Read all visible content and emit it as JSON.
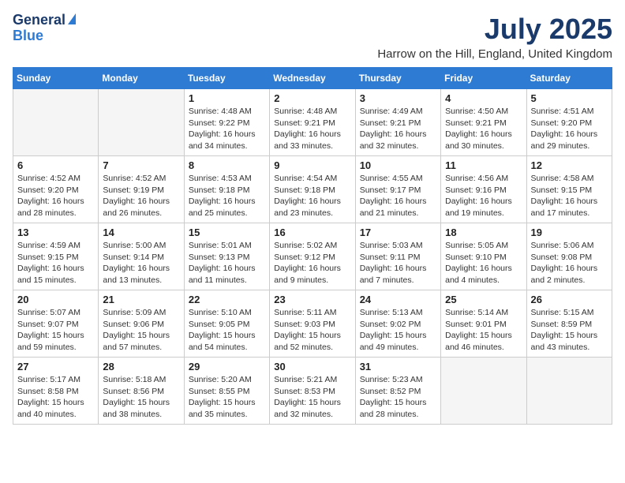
{
  "logo": {
    "line1": "General",
    "line2": "Blue"
  },
  "title": "July 2025",
  "location": "Harrow on the Hill, England, United Kingdom",
  "weekdays": [
    "Sunday",
    "Monday",
    "Tuesday",
    "Wednesday",
    "Thursday",
    "Friday",
    "Saturday"
  ],
  "weeks": [
    [
      {
        "day": "",
        "detail": ""
      },
      {
        "day": "",
        "detail": ""
      },
      {
        "day": "1",
        "detail": "Sunrise: 4:48 AM\nSunset: 9:22 PM\nDaylight: 16 hours\nand 34 minutes."
      },
      {
        "day": "2",
        "detail": "Sunrise: 4:48 AM\nSunset: 9:21 PM\nDaylight: 16 hours\nand 33 minutes."
      },
      {
        "day": "3",
        "detail": "Sunrise: 4:49 AM\nSunset: 9:21 PM\nDaylight: 16 hours\nand 32 minutes."
      },
      {
        "day": "4",
        "detail": "Sunrise: 4:50 AM\nSunset: 9:21 PM\nDaylight: 16 hours\nand 30 minutes."
      },
      {
        "day": "5",
        "detail": "Sunrise: 4:51 AM\nSunset: 9:20 PM\nDaylight: 16 hours\nand 29 minutes."
      }
    ],
    [
      {
        "day": "6",
        "detail": "Sunrise: 4:52 AM\nSunset: 9:20 PM\nDaylight: 16 hours\nand 28 minutes."
      },
      {
        "day": "7",
        "detail": "Sunrise: 4:52 AM\nSunset: 9:19 PM\nDaylight: 16 hours\nand 26 minutes."
      },
      {
        "day": "8",
        "detail": "Sunrise: 4:53 AM\nSunset: 9:18 PM\nDaylight: 16 hours\nand 25 minutes."
      },
      {
        "day": "9",
        "detail": "Sunrise: 4:54 AM\nSunset: 9:18 PM\nDaylight: 16 hours\nand 23 minutes."
      },
      {
        "day": "10",
        "detail": "Sunrise: 4:55 AM\nSunset: 9:17 PM\nDaylight: 16 hours\nand 21 minutes."
      },
      {
        "day": "11",
        "detail": "Sunrise: 4:56 AM\nSunset: 9:16 PM\nDaylight: 16 hours\nand 19 minutes."
      },
      {
        "day": "12",
        "detail": "Sunrise: 4:58 AM\nSunset: 9:15 PM\nDaylight: 16 hours\nand 17 minutes."
      }
    ],
    [
      {
        "day": "13",
        "detail": "Sunrise: 4:59 AM\nSunset: 9:15 PM\nDaylight: 16 hours\nand 15 minutes."
      },
      {
        "day": "14",
        "detail": "Sunrise: 5:00 AM\nSunset: 9:14 PM\nDaylight: 16 hours\nand 13 minutes."
      },
      {
        "day": "15",
        "detail": "Sunrise: 5:01 AM\nSunset: 9:13 PM\nDaylight: 16 hours\nand 11 minutes."
      },
      {
        "day": "16",
        "detail": "Sunrise: 5:02 AM\nSunset: 9:12 PM\nDaylight: 16 hours\nand 9 minutes."
      },
      {
        "day": "17",
        "detail": "Sunrise: 5:03 AM\nSunset: 9:11 PM\nDaylight: 16 hours\nand 7 minutes."
      },
      {
        "day": "18",
        "detail": "Sunrise: 5:05 AM\nSunset: 9:10 PM\nDaylight: 16 hours\nand 4 minutes."
      },
      {
        "day": "19",
        "detail": "Sunrise: 5:06 AM\nSunset: 9:08 PM\nDaylight: 16 hours\nand 2 minutes."
      }
    ],
    [
      {
        "day": "20",
        "detail": "Sunrise: 5:07 AM\nSunset: 9:07 PM\nDaylight: 15 hours\nand 59 minutes."
      },
      {
        "day": "21",
        "detail": "Sunrise: 5:09 AM\nSunset: 9:06 PM\nDaylight: 15 hours\nand 57 minutes."
      },
      {
        "day": "22",
        "detail": "Sunrise: 5:10 AM\nSunset: 9:05 PM\nDaylight: 15 hours\nand 54 minutes."
      },
      {
        "day": "23",
        "detail": "Sunrise: 5:11 AM\nSunset: 9:03 PM\nDaylight: 15 hours\nand 52 minutes."
      },
      {
        "day": "24",
        "detail": "Sunrise: 5:13 AM\nSunset: 9:02 PM\nDaylight: 15 hours\nand 49 minutes."
      },
      {
        "day": "25",
        "detail": "Sunrise: 5:14 AM\nSunset: 9:01 PM\nDaylight: 15 hours\nand 46 minutes."
      },
      {
        "day": "26",
        "detail": "Sunrise: 5:15 AM\nSunset: 8:59 PM\nDaylight: 15 hours\nand 43 minutes."
      }
    ],
    [
      {
        "day": "27",
        "detail": "Sunrise: 5:17 AM\nSunset: 8:58 PM\nDaylight: 15 hours\nand 40 minutes."
      },
      {
        "day": "28",
        "detail": "Sunrise: 5:18 AM\nSunset: 8:56 PM\nDaylight: 15 hours\nand 38 minutes."
      },
      {
        "day": "29",
        "detail": "Sunrise: 5:20 AM\nSunset: 8:55 PM\nDaylight: 15 hours\nand 35 minutes."
      },
      {
        "day": "30",
        "detail": "Sunrise: 5:21 AM\nSunset: 8:53 PM\nDaylight: 15 hours\nand 32 minutes."
      },
      {
        "day": "31",
        "detail": "Sunrise: 5:23 AM\nSunset: 8:52 PM\nDaylight: 15 hours\nand 28 minutes."
      },
      {
        "day": "",
        "detail": ""
      },
      {
        "day": "",
        "detail": ""
      }
    ]
  ]
}
